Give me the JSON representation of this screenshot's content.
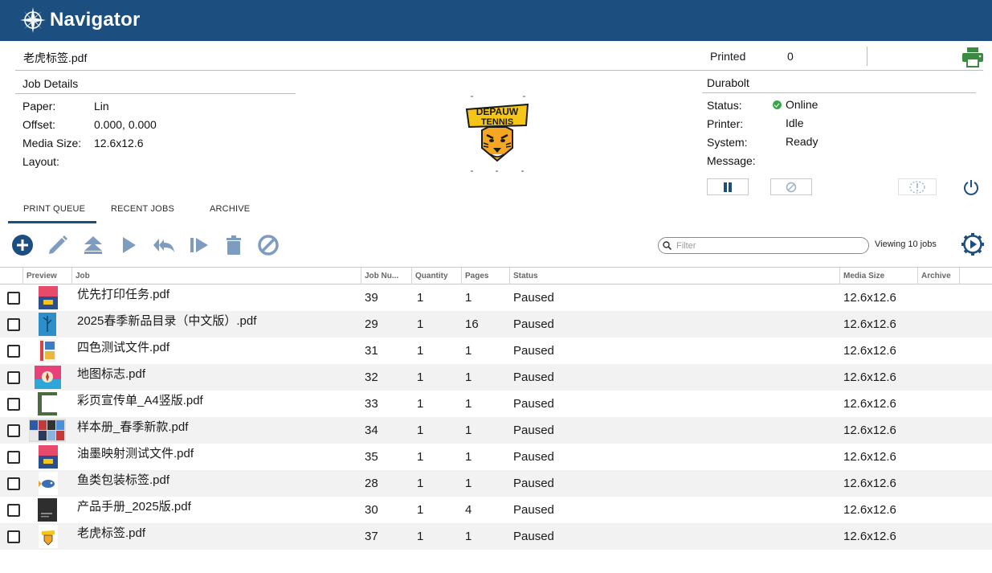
{
  "app": {
    "name": "Navigator"
  },
  "header": {
    "file_title": "老虎标签.pdf",
    "printed_label": "Printed",
    "printed_value": "0"
  },
  "job_details": {
    "title": "Job Details",
    "paper_label": "Paper:",
    "paper_value": "Lin",
    "offset_label": "Offset:",
    "offset_value": "0.000, 0.000",
    "media_label": "Media Size:",
    "media_value": "12.6x12.6",
    "layout_label": "Layout:",
    "layout_value": ""
  },
  "printer": {
    "name": "Durabolt",
    "status_label": "Status:",
    "status_value": "Online",
    "printer_label": "Printer:",
    "printer_value": "Idle",
    "system_label": "System:",
    "system_value": "Ready",
    "message_label": "Message:",
    "message_value": ""
  },
  "tabs": [
    {
      "label": "PRINT QUEUE"
    },
    {
      "label": "RECENT JOBS"
    },
    {
      "label": "ARCHIVE"
    }
  ],
  "toolbar": {
    "filter_placeholder": "Filter",
    "viewing_text": "Viewing 10 jobs"
  },
  "table": {
    "headers": {
      "preview": "Preview",
      "job": "Job",
      "job_number": "Job Nu...",
      "quantity": "Quantity",
      "pages": "Pages",
      "status": "Status",
      "media_size": "Media Size",
      "archive": "Archive"
    },
    "rows": [
      {
        "job": "优先打印任务.pdf",
        "job_number": "39",
        "quantity": "1",
        "pages": "1",
        "status": "Paused",
        "media_size": "12.6x12.6"
      },
      {
        "job": "2025春季新品目录（中文版）.pdf",
        "job_number": "29",
        "quantity": "1",
        "pages": "16",
        "status": "Paused",
        "media_size": "12.6x12.6"
      },
      {
        "job": "四色测试文件.pdf",
        "job_number": "31",
        "quantity": "1",
        "pages": "1",
        "status": "Paused",
        "media_size": "12.6x12.6"
      },
      {
        "job": "地图标志.pdf",
        "job_number": "32",
        "quantity": "1",
        "pages": "1",
        "status": "Paused",
        "media_size": "12.6x12.6"
      },
      {
        "job": "彩页宣传单_A4竖版.pdf",
        "job_number": "33",
        "quantity": "1",
        "pages": "1",
        "status": "Paused",
        "media_size": "12.6x12.6"
      },
      {
        "job": "样本册_春季新款.pdf",
        "job_number": "34",
        "quantity": "1",
        "pages": "1",
        "status": "Paused",
        "media_size": "12.6x12.6"
      },
      {
        "job": "油墨映射测试文件.pdf",
        "job_number": "35",
        "quantity": "1",
        "pages": "1",
        "status": "Paused",
        "media_size": "12.6x12.6"
      },
      {
        "job": "鱼类包装标签.pdf",
        "job_number": "28",
        "quantity": "1",
        "pages": "1",
        "status": "Paused",
        "media_size": "12.6x12.6"
      },
      {
        "job": "产品手册_2025版.pdf",
        "job_number": "30",
        "quantity": "1",
        "pages": "4",
        "status": "Paused",
        "media_size": "12.6x12.6"
      },
      {
        "job": "老虎标签.pdf",
        "job_number": "37",
        "quantity": "1",
        "pages": "1",
        "status": "Paused",
        "media_size": "12.6x12.6"
      }
    ]
  },
  "preview": {
    "logo_line1": "DEPAUW",
    "logo_line2": "TENNIS"
  },
  "colors": {
    "brand": "#1c4e80",
    "icon": "#1c4e80",
    "icon_light": "#7d9cc0",
    "status_online": "#3ca54a",
    "print_icon": "#3a8a3f"
  }
}
